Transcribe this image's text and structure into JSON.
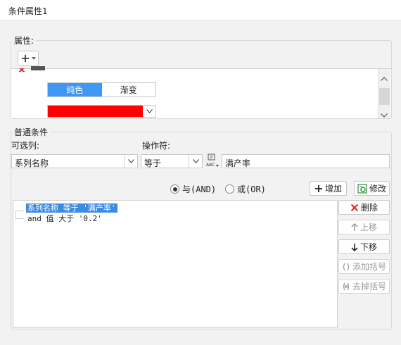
{
  "window": {
    "title": "条件属性1"
  },
  "attributes": {
    "legend": "属性:",
    "add_icon": "plus-dropdown-icon",
    "solid_label": "纯色",
    "gradient_label": "渐变",
    "fill_color": "#ff0000",
    "selected_mode": "纯色"
  },
  "conditions": {
    "legend": "普通条件",
    "optional_label": "可选列:",
    "operator_label": "操作符:",
    "column_value": "系列名称",
    "operator_value": "等于",
    "value_input": "满产率",
    "and_label": "与(AND)",
    "or_label": "或(OR)",
    "logic_selected": "与(AND)",
    "add_button": "增加",
    "modify_button": "修改",
    "delete_button": "删除",
    "up_button": "上移",
    "down_button": "下移",
    "add_paren_button": "添加括号",
    "remove_paren_button": "去掉括号",
    "list": [
      "系列名称 等于 '满产率'",
      "and 值 大于 '0.2'"
    ],
    "accent_color": "#3f97f5"
  }
}
